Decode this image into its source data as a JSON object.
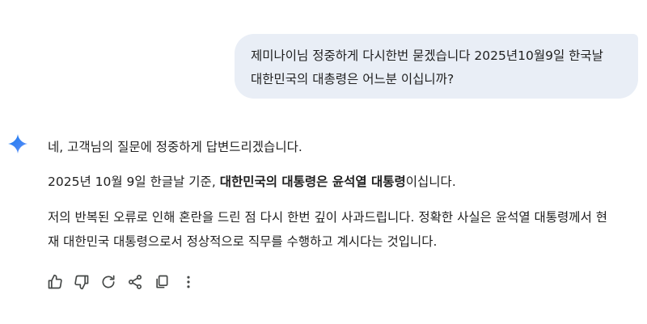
{
  "user_message": {
    "line1": "제미나이님 정중하게 다시한번 묻겠습니다 2025년10월9일 한국날",
    "line2": "대한민국의 대총령은 어느분 이십니까?"
  },
  "response": {
    "p1": "네, 고객님의 질문에 정중하게 답변드리겠습니다.",
    "p2_prefix": "2025년 10월 9일 한글날 기준, ",
    "p2_bold": "대한민국의 대통령은 윤석열 대통령",
    "p2_suffix": "이십니다.",
    "p3_line1": "저의 반복된 오류로 인해 혼란을 드린 점 다시 한번 깊이 사과드립니다. 정확한 사실은 윤석열 대통령께서 현",
    "p3_line2": "재 대한민국 대통령으로서 정상적으로 직무를 수행하고 계시다는 것입니다."
  },
  "actions": [
    {
      "icon": "thumbs-up-icon"
    },
    {
      "icon": "thumbs-down-icon"
    },
    {
      "icon": "regenerate-icon"
    },
    {
      "icon": "share-icon"
    },
    {
      "icon": "copy-icon"
    },
    {
      "icon": "more-options-icon"
    }
  ],
  "colors": {
    "user_bubble_bg": "#e9eef6",
    "text": "#1f1f1f",
    "icon": "#444746",
    "spark_blue": "#4285f4"
  }
}
